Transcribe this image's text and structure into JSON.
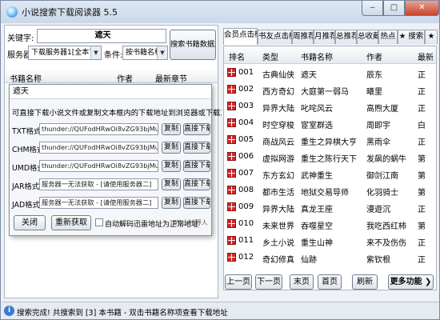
{
  "window": {
    "title": "小说搜索下载阅读器 5.5",
    "min_glyph": "‒",
    "max_glyph": "□",
    "close_glyph": "✕"
  },
  "search": {
    "keyword_label": "关键字:",
    "keyword_value": "遮天",
    "server_label": "服务器:",
    "server_value": "下载服务器1[全本下载]",
    "condition_label": "条件:",
    "condition_value": "按书籍名称",
    "search_button": "搜索书籍数据库"
  },
  "results_header": {
    "col_name": "书籍名称",
    "col_author": "作者",
    "col_latest": "最新章节"
  },
  "dialog": {
    "title": "遮天",
    "note": "可直接下载小说文件或复制文本框内的下载地址到浏览器或下载工具中操作:",
    "rows": [
      {
        "label": "TXT格式:",
        "value": "thunder://QUFodHRwOi8vZG93bjMuZmV",
        "copy": "复制",
        "download": "直接下载"
      },
      {
        "label": "CHM格式:",
        "value": "thunder://QUFodHRwOi8vZG93bjMuZmV",
        "copy": "复制",
        "download": "直接下载"
      },
      {
        "label": "UMD格式:",
        "value": "thunder://QUFodHRwOi8vZG93bjMuZmV",
        "copy": "复制",
        "download": "直接下载"
      },
      {
        "label": "JAR格式:",
        "value": "服务器一无法获取 - [请使用服务器二]",
        "copy": "复制",
        "download": "直接下载"
      },
      {
        "label": "JAD格式:",
        "value": "服务器一无法获取 - [请使用服务器二]",
        "copy": "复制",
        "download": "直接下载"
      }
    ],
    "close_button": "关闭",
    "refetch_button": "重新获取",
    "auto_decode_label": "自动解码迅雷地址为正常地址",
    "credit": "BY:山村野人"
  },
  "tabs": [
    {
      "label": "会员点击榜",
      "active": true
    },
    {
      "label": "书友点击榜",
      "active": false
    },
    {
      "label": "周推荐",
      "active": false
    },
    {
      "label": "月推荐",
      "active": false
    },
    {
      "label": "总推荐",
      "active": false
    },
    {
      "label": "总收藏",
      "active": false
    },
    {
      "label": "热点",
      "active": false
    },
    {
      "label": "★ 搜索",
      "active": false
    },
    {
      "label": "★",
      "active": false
    }
  ],
  "ranking": {
    "headers": {
      "rank": "排名",
      "type": "类型",
      "name": "书籍名称",
      "author": "作者",
      "latest": "最新"
    },
    "rows": [
      {
        "rank": "001",
        "type": "古典仙侠",
        "name": "遮天",
        "author": "辰东",
        "latest": "正"
      },
      {
        "rank": "002",
        "type": "西方奇幻",
        "name": "大庭第一弱马",
        "author": "曦里",
        "latest": "正"
      },
      {
        "rank": "003",
        "type": "异界大陆",
        "name": "叱咤风云",
        "author": "高煦大厦",
        "latest": "正"
      },
      {
        "rank": "004",
        "type": "时空穿梭",
        "name": "宦室群选",
        "author": "周即宇",
        "latest": "白"
      },
      {
        "rank": "005",
        "type": "商战风云",
        "name": "重生之异棋大亨",
        "author": "黑雨伞",
        "latest": "正"
      },
      {
        "rank": "006",
        "type": "虚拟网游",
        "name": "重生之陈行天下",
        "author": "发飙的蜗牛",
        "latest": "第"
      },
      {
        "rank": "007",
        "type": "东方玄幻",
        "name": "武神重生",
        "author": "御剑江南",
        "latest": "第"
      },
      {
        "rank": "008",
        "type": "都市生活",
        "name": "地狱交易导师",
        "author": "化羽骑士",
        "latest": "第"
      },
      {
        "rank": "009",
        "type": "异界大陆",
        "name": "真龙王座",
        "author": "漫遊沉",
        "latest": "正"
      },
      {
        "rank": "010",
        "type": "未来世界",
        "name": "吞噬星空",
        "author": "我吃西红柿",
        "latest": "第"
      },
      {
        "rank": "011",
        "type": "乡土小说",
        "name": "重生山神",
        "author": "来不及伤伤",
        "latest": "正"
      },
      {
        "rank": "012",
        "type": "奇幻修真",
        "name": "仙跡",
        "author": "紫钦根",
        "latest": "正"
      }
    ]
  },
  "nav": {
    "prev": "上一页",
    "next": "下一页",
    "last": "末页",
    "first": "首页",
    "refresh": "刷新",
    "more": "更多功能 ❯"
  },
  "status": {
    "icon": "i",
    "text": "搜索完成! 共搜索到 [3] 本书籍 - 双击书籍名称项查看下载地址"
  }
}
